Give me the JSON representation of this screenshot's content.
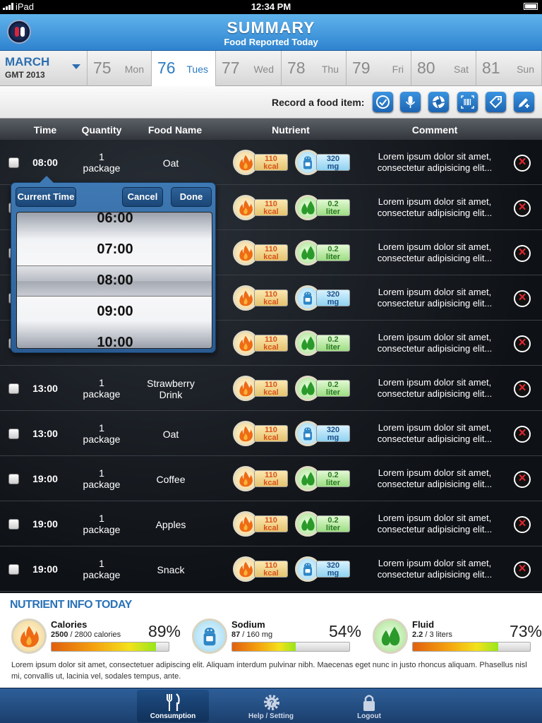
{
  "status": {
    "carrier": "iPad",
    "time": "12:34 PM"
  },
  "header": {
    "title": "SUMMARY",
    "subtitle": "Food Reported Today"
  },
  "datebar": {
    "month": "MARCH",
    "year": "GMT 2013",
    "days": [
      {
        "num": "75",
        "name": "Mon"
      },
      {
        "num": "76",
        "name": "Tues"
      },
      {
        "num": "77",
        "name": "Wed"
      },
      {
        "num": "78",
        "name": "Thu"
      },
      {
        "num": "79",
        "name": "Fri"
      },
      {
        "num": "80",
        "name": "Sat"
      },
      {
        "num": "81",
        "name": "Sun"
      }
    ],
    "selected_index": 1
  },
  "record": {
    "label": "Record a food item:",
    "buttons": [
      "check-icon",
      "microphone-icon",
      "camera-shutter-icon",
      "barcode-icon",
      "tag-icon",
      "add-edit-icon"
    ]
  },
  "table": {
    "headers": {
      "time": "Time",
      "quantity": "Quantity",
      "food": "Food Name",
      "nutrient": "Nutrient",
      "comment": "Comment"
    },
    "rows": [
      {
        "time": "08:00",
        "qty1": "1",
        "qty2": "package",
        "food": "Oat",
        "cal": "110",
        "cal_u": "kcal",
        "n2type": "sodium",
        "n2": "320",
        "n2u": "mg",
        "comment": "Lorem ipsum dolor sit amet, consectetur adipisicing elit..."
      },
      {
        "time": "",
        "qty1": "",
        "qty2": "",
        "food": "",
        "cal": "110",
        "cal_u": "kcal",
        "n2type": "fluid",
        "n2": "0.2",
        "n2u": "liter",
        "comment": "Lorem ipsum dolor sit amet, consectetur adipisicing elit..."
      },
      {
        "time": "",
        "qty1": "",
        "qty2": "",
        "food": "",
        "cal": "110",
        "cal_u": "kcal",
        "n2type": "fluid",
        "n2": "0.2",
        "n2u": "liter",
        "comment": "Lorem ipsum dolor sit amet, consectetur adipisicing elit..."
      },
      {
        "time": "",
        "qty1": "",
        "qty2": "",
        "food": "",
        "cal": "110",
        "cal_u": "kcal",
        "n2type": "sodium",
        "n2": "320",
        "n2u": "mg",
        "comment": "Lorem ipsum dolor sit amet, consectetur adipisicing elit..."
      },
      {
        "time": "",
        "qty1": "",
        "qty2": "",
        "food": "",
        "cal": "110",
        "cal_u": "kcal",
        "n2type": "fluid",
        "n2": "0.2",
        "n2u": "liter",
        "comment": "Lorem ipsum dolor sit amet, consectetur adipisicing elit..."
      },
      {
        "time": "13:00",
        "qty1": "1",
        "qty2": "package",
        "food": "Strawberry Drink",
        "cal": "110",
        "cal_u": "kcal",
        "n2type": "fluid",
        "n2": "0.2",
        "n2u": "liter",
        "comment": "Lorem ipsum dolor sit amet, consectetur adipisicing elit..."
      },
      {
        "time": "13:00",
        "qty1": "1",
        "qty2": "package",
        "food": "Oat",
        "cal": "110",
        "cal_u": "kcal",
        "n2type": "sodium",
        "n2": "320",
        "n2u": "mg",
        "comment": "Lorem ipsum dolor sit amet, consectetur adipisicing elit..."
      },
      {
        "time": "19:00",
        "qty1": "1",
        "qty2": "package",
        "food": "Coffee",
        "cal": "110",
        "cal_u": "kcal",
        "n2type": "fluid",
        "n2": "0.2",
        "n2u": "liter",
        "comment": "Lorem ipsum dolor sit amet, consectetur adipisicing elit..."
      },
      {
        "time": "19:00",
        "qty1": "1",
        "qty2": "package",
        "food": "Apples",
        "cal": "110",
        "cal_u": "kcal",
        "n2type": "fluid",
        "n2": "0.2",
        "n2u": "liter",
        "comment": "Lorem ipsum dolor sit amet, consectetur adipisicing elit..."
      },
      {
        "time": "19:00",
        "qty1": "1",
        "qty2": "package",
        "food": "Snack",
        "cal": "110",
        "cal_u": "kcal",
        "n2type": "sodium",
        "n2": "320",
        "n2u": "mg",
        "comment": "Lorem ipsum dolor sit amet, consectetur adipisicing elit..."
      }
    ]
  },
  "picker": {
    "current_label": "Current Time",
    "cancel_label": "Cancel",
    "done_label": "Done",
    "options": [
      "06:00",
      "07:00",
      "08:00",
      "09:00",
      "10:00"
    ],
    "selected": "08:00"
  },
  "nutrient_info": {
    "heading": "NUTRIENT INFO TODAY",
    "stats": [
      {
        "name": "Calories",
        "value": "2500",
        "rest": " / 2800 calories",
        "pct": "89%",
        "fraction": 0.89,
        "icon": "flame-icon"
      },
      {
        "name": "Sodium",
        "value": "87",
        "rest": " / 160 mg",
        "pct": "54%",
        "fraction": 0.54,
        "icon": "salt-shaker-icon"
      },
      {
        "name": "Fluid",
        "value": "2.2",
        "rest": " / 3 liters",
        "pct": "73%",
        "fraction": 0.73,
        "icon": "droplets-icon"
      }
    ],
    "description": "Lorem ipsum dolor sit amet, consectetuer adipiscing elit. Aliquam interdum pulvinar nibh. Maecenas eget nunc in justo rhoncus aliquam. Phasellus nisl mi, convallis ut, lacinia vel, sodales tempus, ante."
  },
  "tabs": [
    {
      "label": "Consumption",
      "icon": "fork-knife-icon",
      "active": true
    },
    {
      "label": "Help / Setting",
      "icon": "gear-question-icon",
      "active": false
    },
    {
      "label": "Logout",
      "icon": "lock-icon",
      "active": false
    }
  ],
  "colors": {
    "accent": "#2d7bc4",
    "header_top": "#5fb3ec",
    "header_bottom": "#2f83cf",
    "delete": "#e0262e"
  }
}
